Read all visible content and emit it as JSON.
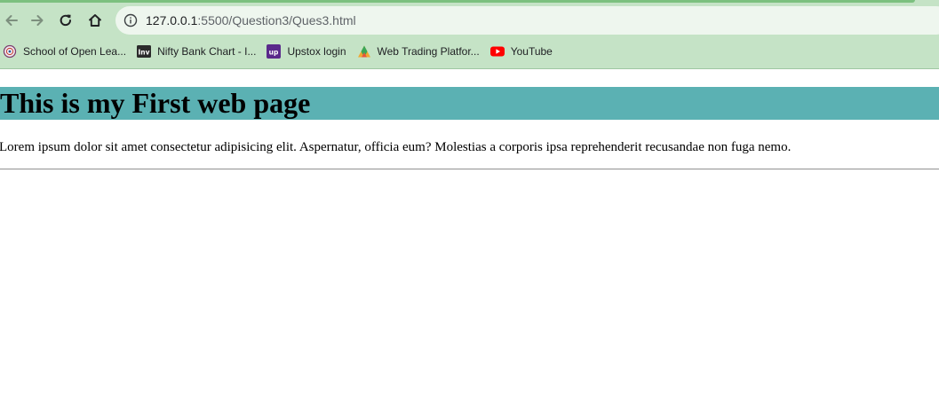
{
  "browser": {
    "url": {
      "host": "127.0.0.1",
      "path": ":5500/Question3/Ques3.html"
    },
    "bookmarks": [
      {
        "label": "School of Open Lea...",
        "icon": "school-seal-icon"
      },
      {
        "label": "Nifty Bank Chart - I...",
        "icon": "investing-inv-icon"
      },
      {
        "label": "Upstox login",
        "icon": "upstox-up-icon"
      },
      {
        "label": "Web Trading Platfor...",
        "icon": "trading-triangle-icon"
      },
      {
        "label": "YouTube",
        "icon": "youtube-play-icon"
      }
    ],
    "colors": {
      "toolbar": "#c5e3c6",
      "omnibox": "#eef6ee"
    }
  },
  "page": {
    "heading": "This is my First web page",
    "paragraph": "Lorem ipsum dolor sit amet consectetur adipisicing elit. Aspernatur, officia eum? Molestias a corporis ipsa reprehenderit recusandae non fuga nemo.",
    "colors": {
      "heading_bg": "#5bb1b3"
    }
  }
}
